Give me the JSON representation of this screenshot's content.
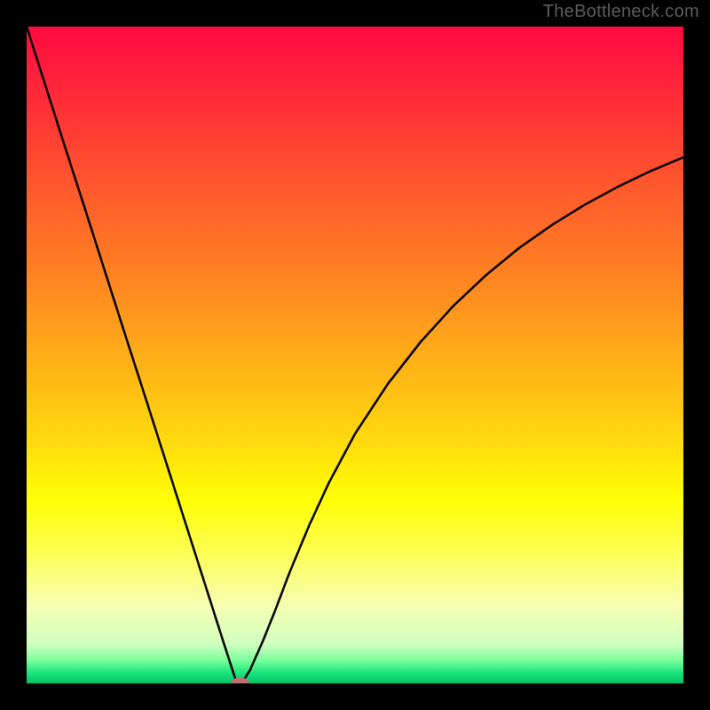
{
  "watermark": "TheBottleneck.com",
  "chart_data": {
    "type": "line",
    "title": "",
    "xlabel": "",
    "ylabel": "",
    "xlim": [
      0,
      100
    ],
    "ylim": [
      0,
      100
    ],
    "grid": false,
    "legend": false,
    "annotations": [],
    "background_gradient_stops": [
      {
        "pct": 0.0,
        "color": "#ff0a41"
      },
      {
        "pct": 0.12,
        "color": "#ff2f37"
      },
      {
        "pct": 0.25,
        "color": "#ff5a2c"
      },
      {
        "pct": 0.38,
        "color": "#ff8322"
      },
      {
        "pct": 0.5,
        "color": "#ffad18"
      },
      {
        "pct": 0.62,
        "color": "#ffd60f"
      },
      {
        "pct": 0.72,
        "color": "#ffff05"
      },
      {
        "pct": 0.8,
        "color": "#fdff53"
      },
      {
        "pct": 0.88,
        "color": "#f7ffb2"
      },
      {
        "pct": 0.94,
        "color": "#d1ffbf"
      },
      {
        "pct": 0.965,
        "color": "#7aff9c"
      },
      {
        "pct": 0.985,
        "color": "#15e47b"
      },
      {
        "pct": 1.0,
        "color": "#07c166"
      }
    ],
    "series": [
      {
        "name": "curve",
        "x": [
          0,
          3,
          6,
          9,
          12,
          15,
          18,
          21,
          24,
          27,
          30,
          31,
          31.8,
          32.5,
          33,
          34,
          36,
          38,
          40,
          43,
          46,
          50,
          55,
          60,
          65,
          70,
          75,
          80,
          85,
          90,
          95,
          100
        ],
        "y": [
          100,
          90.6,
          81.2,
          71.9,
          62.5,
          53.1,
          43.8,
          34.4,
          25,
          15.6,
          6.2,
          3.1,
          0.6,
          0.0,
          0.4,
          2.0,
          6.5,
          11.5,
          16.8,
          24.0,
          30.5,
          38.0,
          45.6,
          52.0,
          57.5,
          62.2,
          66.3,
          69.8,
          72.9,
          75.6,
          78.0,
          80.1
        ]
      }
    ],
    "marker": {
      "x": 32.5,
      "y": 0,
      "rx": 1.4,
      "ry": 0.9,
      "color": "#c07072"
    }
  }
}
